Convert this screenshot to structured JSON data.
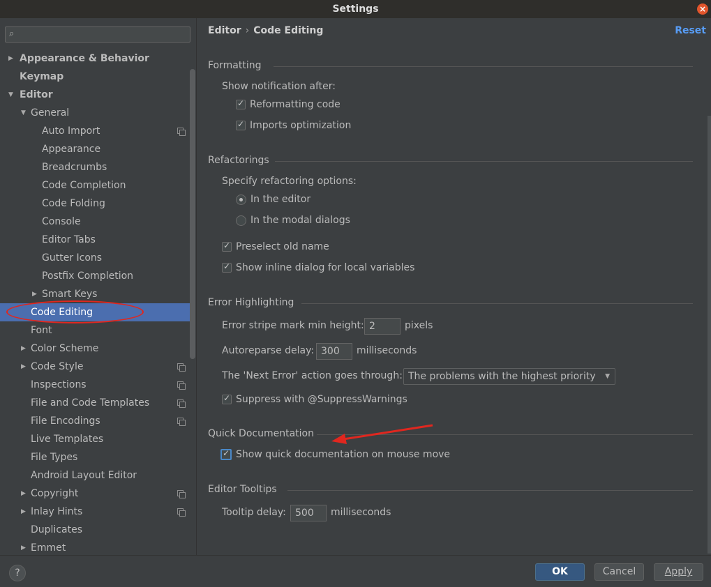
{
  "window": {
    "title": "Settings",
    "close_glyph": "×"
  },
  "sidebar": {
    "search_placeholder": "",
    "items": [
      {
        "label": "Appearance & Behavior",
        "bold": true,
        "arrow": "right",
        "level": 0
      },
      {
        "label": "Keymap",
        "bold": true,
        "arrow": "",
        "level": 0
      },
      {
        "label": "Editor",
        "bold": true,
        "arrow": "down",
        "level": 0
      },
      {
        "label": "General",
        "bold": false,
        "arrow": "down",
        "level": 1
      },
      {
        "label": "Auto Import",
        "bold": false,
        "arrow": "",
        "level": 2,
        "copy": true
      },
      {
        "label": "Appearance",
        "bold": false,
        "arrow": "",
        "level": 2
      },
      {
        "label": "Breadcrumbs",
        "bold": false,
        "arrow": "",
        "level": 2
      },
      {
        "label": "Code Completion",
        "bold": false,
        "arrow": "",
        "level": 2
      },
      {
        "label": "Code Folding",
        "bold": false,
        "arrow": "",
        "level": 2
      },
      {
        "label": "Console",
        "bold": false,
        "arrow": "",
        "level": 2
      },
      {
        "label": "Editor Tabs",
        "bold": false,
        "arrow": "",
        "level": 2
      },
      {
        "label": "Gutter Icons",
        "bold": false,
        "arrow": "",
        "level": 2
      },
      {
        "label": "Postfix Completion",
        "bold": false,
        "arrow": "",
        "level": 2
      },
      {
        "label": "Smart Keys",
        "bold": false,
        "arrow": "right",
        "level": 2
      },
      {
        "label": "Code Editing",
        "bold": false,
        "arrow": "",
        "level": 1,
        "selected": true
      },
      {
        "label": "Font",
        "bold": false,
        "arrow": "",
        "level": 1
      },
      {
        "label": "Color Scheme",
        "bold": false,
        "arrow": "right",
        "level": 1
      },
      {
        "label": "Code Style",
        "bold": false,
        "arrow": "right",
        "level": 1,
        "copy": true
      },
      {
        "label": "Inspections",
        "bold": false,
        "arrow": "",
        "level": 1,
        "copy": true
      },
      {
        "label": "File and Code Templates",
        "bold": false,
        "arrow": "",
        "level": 1,
        "copy": true
      },
      {
        "label": "File Encodings",
        "bold": false,
        "arrow": "",
        "level": 1,
        "copy": true
      },
      {
        "label": "Live Templates",
        "bold": false,
        "arrow": "",
        "level": 1
      },
      {
        "label": "File Types",
        "bold": false,
        "arrow": "",
        "level": 1
      },
      {
        "label": "Android Layout Editor",
        "bold": false,
        "arrow": "",
        "level": 1
      },
      {
        "label": "Copyright",
        "bold": false,
        "arrow": "right",
        "level": 1,
        "copy": true
      },
      {
        "label": "Inlay Hints",
        "bold": false,
        "arrow": "right",
        "level": 1,
        "copy": true
      },
      {
        "label": "Duplicates",
        "bold": false,
        "arrow": "",
        "level": 1
      },
      {
        "label": "Emmet",
        "bold": false,
        "arrow": "right",
        "level": 1
      }
    ]
  },
  "main": {
    "breadcrumb": {
      "parent": "Editor",
      "separator": "›",
      "current": "Code Editing"
    },
    "reset_label": "Reset",
    "formatting": {
      "title": "Formatting",
      "show_notification_label": "Show notification after:",
      "reformatting_code": {
        "label": "Reformatting code",
        "checked": true
      },
      "imports_optimization": {
        "label": "Imports optimization",
        "checked": true
      }
    },
    "refactorings": {
      "title": "Refactorings",
      "specify_label": "Specify refactoring options:",
      "in_editor": {
        "label": "In the editor",
        "selected": true
      },
      "in_modal": {
        "label": "In the modal dialogs",
        "selected": false
      },
      "preselect_old_name": {
        "label": "Preselect old name",
        "checked": true
      },
      "show_inline_dialog": {
        "label": "Show inline dialog for local variables",
        "checked": true
      }
    },
    "error_highlighting": {
      "title": "Error Highlighting",
      "stripe_label": "Error stripe mark min height:",
      "stripe_value": "2",
      "stripe_unit": "pixels",
      "autoreparse_label": "Autoreparse delay:",
      "autoreparse_value": "300",
      "autoreparse_unit": "milliseconds",
      "next_error_label": "The 'Next Error' action goes through:",
      "next_error_value": "The problems with the highest priority",
      "suppress": {
        "label": "Suppress with @SuppressWarnings",
        "checked": true
      }
    },
    "quick_documentation": {
      "title": "Quick Documentation",
      "show_on_mouse_move": {
        "label": "Show quick documentation on mouse move",
        "checked": true
      }
    },
    "editor_tooltips": {
      "title": "Editor Tooltips",
      "delay_label": "Tooltip delay:",
      "delay_value": "500",
      "delay_unit": "milliseconds"
    }
  },
  "footer": {
    "help_label": "?",
    "ok_label": "OK",
    "cancel_label": "Cancel",
    "apply_label": "Apply"
  },
  "annotations": {
    "highlight_color": "#e0271f"
  }
}
